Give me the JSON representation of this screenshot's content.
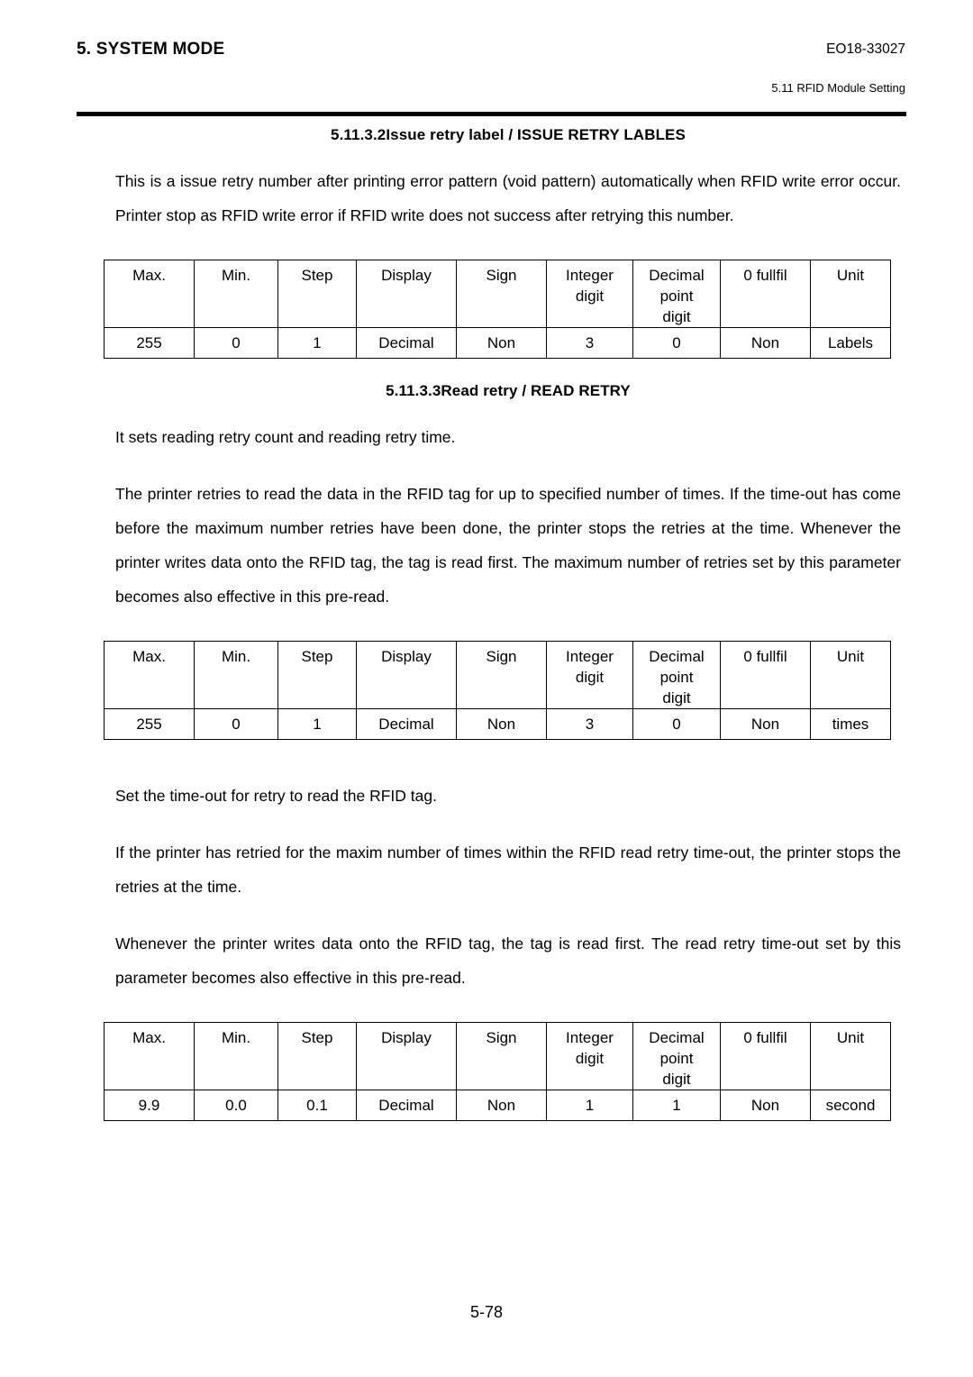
{
  "header": {
    "title": "5. SYSTEM MODE",
    "doc_number": "EO18-33027",
    "subsection": "5.11 RFID Module Setting"
  },
  "sections": [
    {
      "number": "5.11.3.2",
      "name": "Issue retry label / ISSUE RETRY LABLES",
      "paragraphs": [
        "This is a issue retry number after printing error pattern (void pattern) automatically when RFID write error occur. Printer stop as RFID write error if RFID write does not success after retrying this number."
      ]
    },
    {
      "number": "5.11.3.3",
      "name": "Read retry / READ RETRY",
      "paragraphs": [
        "It sets reading retry count and reading retry time.",
        "The printer retries to read the data in the RFID tag for up to specified number of times. If the time-out has come before the maximum number retries have been done, the printer stops the retries at the time. Whenever the printer writes data onto the RFID tag, the tag is read first. The maximum number of retries set by this parameter becomes also effective in this pre-read."
      ],
      "paragraphs_after_table": [
        "Set the time-out for retry to read the RFID tag.",
        "If the printer has retried for the maxim number of times within the RFID read retry time-out, the printer stops the retries at the time.",
        "Whenever the printer writes data onto the RFID tag, the tag is read first. The read retry time-out set by this parameter becomes also effective in this pre-read."
      ]
    }
  ],
  "table_headers": {
    "max": "Max.",
    "min": "Min.",
    "step": "Step",
    "display": "Display",
    "sign": "Sign",
    "integer_digit_line1": "Integer",
    "integer_digit_line2": "digit",
    "decimal_point_digit_line1": "Decimal",
    "decimal_point_digit_line2": "point",
    "decimal_point_digit_line3": "digit",
    "zero_fullfil": "0 fullfil",
    "unit": "Unit"
  },
  "tables": [
    {
      "id": "issue-retry-label",
      "row": {
        "max": "255",
        "min": "0",
        "step": "1",
        "display": "Decimal",
        "sign": "Non",
        "integer_digit": "3",
        "decimal_point_digit": "0",
        "zero_fullfil": "Non",
        "unit": "Labels"
      }
    },
    {
      "id": "read-retry-count",
      "row": {
        "max": "255",
        "min": "0",
        "step": "1",
        "display": "Decimal",
        "sign": "Non",
        "integer_digit": "3",
        "decimal_point_digit": "0",
        "zero_fullfil": "Non",
        "unit": "times"
      }
    },
    {
      "id": "read-retry-timeout",
      "row": {
        "max": "9.9",
        "min": "0.0",
        "step": "0.1",
        "display": "Decimal",
        "sign": "Non",
        "integer_digit": "1",
        "decimal_point_digit": "1",
        "zero_fullfil": "Non",
        "unit": "second"
      }
    }
  ],
  "footer": {
    "page_number": "5-78"
  }
}
